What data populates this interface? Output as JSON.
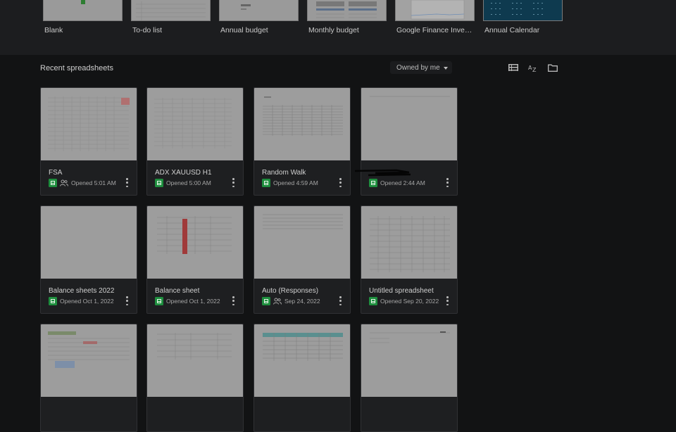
{
  "templates": [
    {
      "label": "Blank"
    },
    {
      "label": "To-do list"
    },
    {
      "label": "Annual budget"
    },
    {
      "label": "Monthly budget"
    },
    {
      "label": "Google Finance Invest..."
    },
    {
      "label": "Annual Calendar"
    }
  ],
  "recent": {
    "title": "Recent spreadsheets",
    "owner_filter": "Owned by me",
    "view_icons": [
      "list-view-icon",
      "sort-az-icon",
      "folder-icon"
    ]
  },
  "files": [
    {
      "title": "FSA",
      "meta": "Opened 5:01 AM",
      "shared": true
    },
    {
      "title": "ADX XAUUSD H1",
      "meta": "Opened 5:00 AM",
      "shared": false
    },
    {
      "title": "Random Walk",
      "meta": "Opened 4:59 AM",
      "shared": false
    },
    {
      "title": "",
      "meta": "Opened 2:44 AM",
      "shared": false
    },
    {
      "title": "Balance sheets 2022",
      "meta": "Opened Oct 1, 2022",
      "shared": false
    },
    {
      "title": "Balance sheet",
      "meta": "Opened Oct 1, 2022",
      "shared": false
    },
    {
      "title": "Auto (Responses)",
      "meta": "Sep 24, 2022",
      "shared": true
    },
    {
      "title": "Untitled spreadsheet",
      "meta": "Opened Sep 20, 2022",
      "shared": false
    },
    {
      "title": "",
      "meta": "",
      "shared": false
    },
    {
      "title": "",
      "meta": "",
      "shared": false
    },
    {
      "title": "",
      "meta": "",
      "shared": false
    },
    {
      "title": "",
      "meta": "",
      "shared": false
    }
  ],
  "colors": {
    "sheets_green": "#1e8e3e",
    "background": "#121314"
  }
}
